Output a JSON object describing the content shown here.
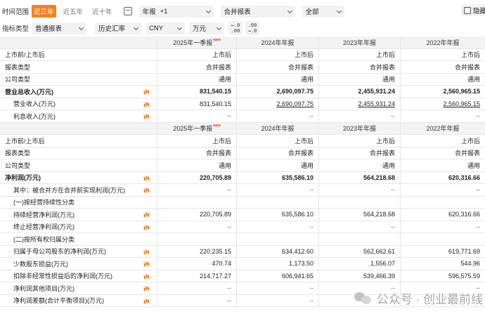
{
  "toolbar": {
    "time_label": "时间范围",
    "ranges": [
      "近三年",
      "近五年",
      "近十年"
    ],
    "period_value": "年报",
    "period_extra": "+1",
    "report_value": "合并报表",
    "scope_value": "全部",
    "hide_label": "隐藏",
    "metric_label": "指标类型",
    "metric_value": "普通报表",
    "rate_value": "历史汇率",
    "currency_value": "CNY",
    "unit_value": "万元",
    "dec_less": "←.0\n.00",
    "dec_more": ".00\n→.0"
  },
  "table1": {
    "headers": [
      "",
      "2025年一季报",
      "2024年年报",
      "2023年年报",
      "2022年年报"
    ],
    "new_tag": "NEW",
    "rows": [
      {
        "label": "上市前/上市后",
        "values": [
          "上市后",
          "上市后",
          "上市后",
          "上市后"
        ]
      },
      {
        "label": "报表类型",
        "values": [
          "合并报表",
          "合并报表",
          "合并报表",
          "合并报表"
        ]
      },
      {
        "label": "公司类型",
        "values": [
          "通用",
          "通用",
          "通用",
          "通用"
        ]
      },
      {
        "label": "营业总收入(万元)",
        "values": [
          "831,540.15",
          "2,690,097.75",
          "2,455,931.24",
          "2,560,965.15"
        ],
        "bold": true,
        "icon": true
      },
      {
        "label": "营业收入(万元)",
        "values": [
          "831,540.15",
          "2,690,097.75",
          "2,455,931.24",
          "2,560,965.15"
        ],
        "indent": true,
        "icon": true,
        "underline": true
      },
      {
        "label": "利息收入(万元)",
        "values": [
          "--",
          "--",
          "--",
          "--"
        ],
        "indent": true,
        "icon": true
      }
    ]
  },
  "table2": {
    "headers": [
      "",
      "2025年一季报",
      "2024年年报",
      "2023年年报",
      "2022年年报"
    ],
    "new_tag": "NEW",
    "rows": [
      {
        "label": "上市前/上市后",
        "values": [
          "上市后",
          "上市后",
          "上市后",
          "上市后"
        ]
      },
      {
        "label": "报表类型",
        "values": [
          "合并报表",
          "合并报表",
          "合并报表",
          "合并报表"
        ]
      },
      {
        "label": "公司类型",
        "values": [
          "通用",
          "通用",
          "通用",
          "通用"
        ]
      },
      {
        "label": "净利润(万元)",
        "values": [
          "220,705.89",
          "635,586.10",
          "564,218.68",
          "620,316.66"
        ],
        "bold": true,
        "icon": true
      },
      {
        "label": "其中：被合并方在合并前实现利润(万元)",
        "values": [
          "--",
          "--",
          "--",
          "--"
        ],
        "indent": true,
        "icon": true
      },
      {
        "label": "(一)按经营持续性分类",
        "values": [
          "",
          "",
          "",
          ""
        ],
        "indent": true
      },
      {
        "label": "持续经营净利润(万元)",
        "values": [
          "220,705.89",
          "635,586.10",
          "564,218.68",
          "620,316.66"
        ],
        "indent": true,
        "icon": true
      },
      {
        "label": "终止经营净利润(万元)",
        "values": [
          "--",
          "--",
          "--",
          "--"
        ],
        "indent": true,
        "icon": true
      },
      {
        "label": "(二)按所有权归属分类",
        "values": [
          "",
          "",
          "",
          ""
        ],
        "indent": true
      },
      {
        "label": "归属于母公司股东的净利润(万元)",
        "values": [
          "220,235.15",
          "634,412.60",
          "562,662.61",
          "619,771.69"
        ],
        "indent": true,
        "icon": true
      },
      {
        "label": "少数股东损益(万元)",
        "values": [
          "470.74",
          "1,173.50",
          "1,556.07",
          "544.96"
        ],
        "indent": true,
        "icon": true
      },
      {
        "label": "扣除非经常性损益后的净利润(万元)",
        "values": [
          "214,717.27",
          "606,941.65",
          "539,466.39",
          "596,575.59"
        ],
        "indent": true,
        "icon": true
      },
      {
        "label": "净利润其他项目(万元)",
        "values": [
          "--",
          "--",
          "--",
          "--"
        ],
        "indent": true,
        "icon": true
      },
      {
        "label": "净利润差额(合计平衡项目)(万元)",
        "values": [
          "--",
          "--",
          "--",
          "--"
        ],
        "indent": true,
        "icon": true
      }
    ]
  },
  "watermark": {
    "text": "公众号 · 创业最前线"
  }
}
